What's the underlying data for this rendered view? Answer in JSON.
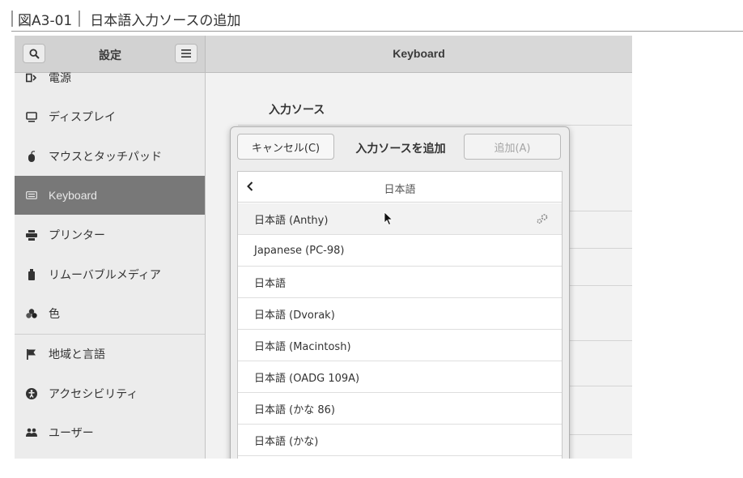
{
  "figure": {
    "id": "図A3-01",
    "title": "日本語入力ソースの追加"
  },
  "header": {
    "sidebar_title": "設定",
    "page_title": "Keyboard",
    "search_icon": "search-icon",
    "menu_icon": "hamburger-menu-icon"
  },
  "sidebar": {
    "items": [
      {
        "label": "電源",
        "icon": "power-icon"
      },
      {
        "label": "ディスプレイ",
        "icon": "display-icon"
      },
      {
        "label": "マウスとタッチパッド",
        "icon": "mouse-icon"
      },
      {
        "label": "Keyboard",
        "icon": "keyboard-icon",
        "selected": true
      },
      {
        "label": "プリンター",
        "icon": "printer-icon"
      },
      {
        "label": "リムーバブルメディア",
        "icon": "usb-drive-icon"
      },
      {
        "label": "色",
        "icon": "color-icon"
      },
      {
        "label": "地域と言語",
        "icon": "flag-icon"
      },
      {
        "label": "アクセシビリティ",
        "icon": "accessibility-icon"
      },
      {
        "label": "ユーザー",
        "icon": "users-icon"
      }
    ]
  },
  "content": {
    "section_label": "入力ソース"
  },
  "dialog": {
    "cancel_label": "キャンセル(C)",
    "title": "入力ソースを追加",
    "add_label": "追加(A)",
    "list_title": "日本語",
    "back_icon": "chevron-left-icon",
    "items": [
      {
        "label": "日本語 (Anthy)",
        "has_settings": true
      },
      {
        "label": "Japanese (PC-98)"
      },
      {
        "label": "日本語"
      },
      {
        "label": "日本語 (Dvorak)"
      },
      {
        "label": "日本語 (Macintosh)"
      },
      {
        "label": "日本語 (OADG 109A)"
      },
      {
        "label": "日本語 (かな 86)"
      },
      {
        "label": "日本語 (かな)"
      }
    ]
  },
  "colors": {
    "selected_item_bg": "#787878",
    "header_bg": "#d8d8d8",
    "disabled_text": "#a5a5a5"
  }
}
